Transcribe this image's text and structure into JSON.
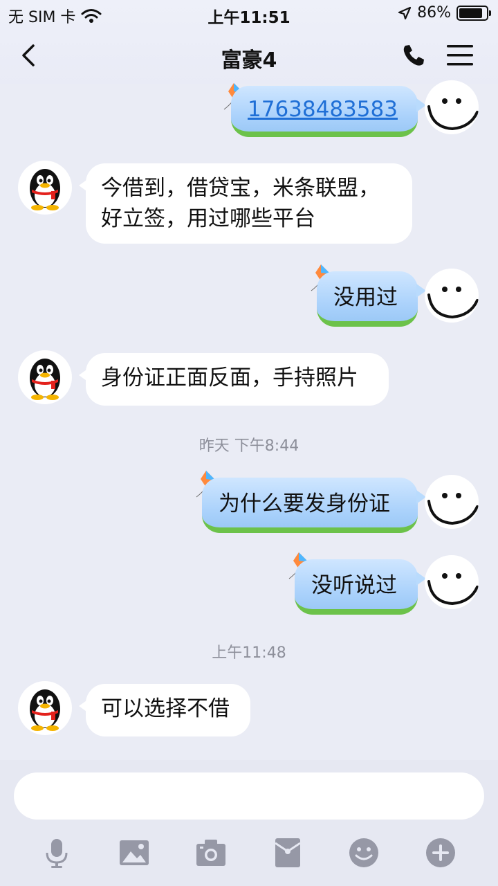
{
  "status_bar": {
    "carrier": "无 SIM 卡",
    "time": "上午11:51",
    "battery_percent": "86%",
    "battery_level": 0.86
  },
  "nav": {
    "title": "富豪4"
  },
  "messages": [
    {
      "direction": "out",
      "text": "17638483583",
      "is_link": true
    },
    {
      "direction": "in",
      "lines": [
        "今借到，借贷宝，米条联盟，",
        "好立签，用过哪些平台"
      ]
    },
    {
      "direction": "out",
      "text": "没用过"
    },
    {
      "direction": "in",
      "text": "身份证正面反面，手持照片"
    },
    {
      "direction": "timestamp",
      "text": "昨天 下午8:44"
    },
    {
      "direction": "out",
      "text": "为什么要发身份证"
    },
    {
      "direction": "out",
      "text": "没听说过"
    },
    {
      "direction": "timestamp",
      "text": "上午11:48"
    },
    {
      "direction": "in",
      "text": "可以选择不借"
    }
  ],
  "input": {
    "value": ""
  },
  "toolbar": [
    "microphone-icon",
    "image-icon",
    "camera-icon",
    "red-packet-icon",
    "emoji-icon",
    "plus-icon"
  ],
  "colors": {
    "background": "#eaecf5",
    "outgoing_bubble": "#a9d1fb",
    "incoming_bubble": "#ffffff",
    "link": "#1f6fd6",
    "toolbar_icon": "#9698a6"
  }
}
